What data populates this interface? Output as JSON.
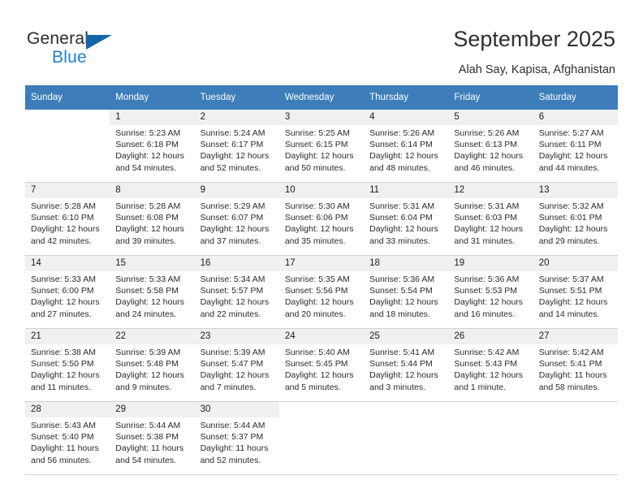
{
  "brand": {
    "word_one": "General",
    "word_two": "Blue",
    "triangle_color": "#1565a8",
    "blue_text_color": "#1f7fd0"
  },
  "header": {
    "title": "September 2025",
    "location": "Alah Say, Kapisa, Afghanistan"
  },
  "calendar": {
    "header_bg": "#3c7dba",
    "daynum_bg": "#f0f0f0",
    "weekday_headers": [
      "Sunday",
      "Monday",
      "Tuesday",
      "Wednesday",
      "Thursday",
      "Friday",
      "Saturday"
    ],
    "labels": {
      "sunrise": "Sunrise:",
      "sunset": "Sunset:",
      "daylight": "Daylight:"
    },
    "weeks": [
      [
        {
          "day": "",
          "sunrise": "",
          "sunset": "",
          "daylight": ""
        },
        {
          "day": "1",
          "sunrise": "Sunrise: 5:23 AM",
          "sunset": "Sunset: 6:18 PM",
          "daylight": "Daylight: 12 hours and 54 minutes."
        },
        {
          "day": "2",
          "sunrise": "Sunrise: 5:24 AM",
          "sunset": "Sunset: 6:17 PM",
          "daylight": "Daylight: 12 hours and 52 minutes."
        },
        {
          "day": "3",
          "sunrise": "Sunrise: 5:25 AM",
          "sunset": "Sunset: 6:15 PM",
          "daylight": "Daylight: 12 hours and 50 minutes."
        },
        {
          "day": "4",
          "sunrise": "Sunrise: 5:26 AM",
          "sunset": "Sunset: 6:14 PM",
          "daylight": "Daylight: 12 hours and 48 minutes."
        },
        {
          "day": "5",
          "sunrise": "Sunrise: 5:26 AM",
          "sunset": "Sunset: 6:13 PM",
          "daylight": "Daylight: 12 hours and 46 minutes."
        },
        {
          "day": "6",
          "sunrise": "Sunrise: 5:27 AM",
          "sunset": "Sunset: 6:11 PM",
          "daylight": "Daylight: 12 hours and 44 minutes."
        }
      ],
      [
        {
          "day": "7",
          "sunrise": "Sunrise: 5:28 AM",
          "sunset": "Sunset: 6:10 PM",
          "daylight": "Daylight: 12 hours and 42 minutes."
        },
        {
          "day": "8",
          "sunrise": "Sunrise: 5:28 AM",
          "sunset": "Sunset: 6:08 PM",
          "daylight": "Daylight: 12 hours and 39 minutes."
        },
        {
          "day": "9",
          "sunrise": "Sunrise: 5:29 AM",
          "sunset": "Sunset: 6:07 PM",
          "daylight": "Daylight: 12 hours and 37 minutes."
        },
        {
          "day": "10",
          "sunrise": "Sunrise: 5:30 AM",
          "sunset": "Sunset: 6:06 PM",
          "daylight": "Daylight: 12 hours and 35 minutes."
        },
        {
          "day": "11",
          "sunrise": "Sunrise: 5:31 AM",
          "sunset": "Sunset: 6:04 PM",
          "daylight": "Daylight: 12 hours and 33 minutes."
        },
        {
          "day": "12",
          "sunrise": "Sunrise: 5:31 AM",
          "sunset": "Sunset: 6:03 PM",
          "daylight": "Daylight: 12 hours and 31 minutes."
        },
        {
          "day": "13",
          "sunrise": "Sunrise: 5:32 AM",
          "sunset": "Sunset: 6:01 PM",
          "daylight": "Daylight: 12 hours and 29 minutes."
        }
      ],
      [
        {
          "day": "14",
          "sunrise": "Sunrise: 5:33 AM",
          "sunset": "Sunset: 6:00 PM",
          "daylight": "Daylight: 12 hours and 27 minutes."
        },
        {
          "day": "15",
          "sunrise": "Sunrise: 5:33 AM",
          "sunset": "Sunset: 5:58 PM",
          "daylight": "Daylight: 12 hours and 24 minutes."
        },
        {
          "day": "16",
          "sunrise": "Sunrise: 5:34 AM",
          "sunset": "Sunset: 5:57 PM",
          "daylight": "Daylight: 12 hours and 22 minutes."
        },
        {
          "day": "17",
          "sunrise": "Sunrise: 5:35 AM",
          "sunset": "Sunset: 5:56 PM",
          "daylight": "Daylight: 12 hours and 20 minutes."
        },
        {
          "day": "18",
          "sunrise": "Sunrise: 5:36 AM",
          "sunset": "Sunset: 5:54 PM",
          "daylight": "Daylight: 12 hours and 18 minutes."
        },
        {
          "day": "19",
          "sunrise": "Sunrise: 5:36 AM",
          "sunset": "Sunset: 5:53 PM",
          "daylight": "Daylight: 12 hours and 16 minutes."
        },
        {
          "day": "20",
          "sunrise": "Sunrise: 5:37 AM",
          "sunset": "Sunset: 5:51 PM",
          "daylight": "Daylight: 12 hours and 14 minutes."
        }
      ],
      [
        {
          "day": "21",
          "sunrise": "Sunrise: 5:38 AM",
          "sunset": "Sunset: 5:50 PM",
          "daylight": "Daylight: 12 hours and 11 minutes."
        },
        {
          "day": "22",
          "sunrise": "Sunrise: 5:39 AM",
          "sunset": "Sunset: 5:48 PM",
          "daylight": "Daylight: 12 hours and 9 minutes."
        },
        {
          "day": "23",
          "sunrise": "Sunrise: 5:39 AM",
          "sunset": "Sunset: 5:47 PM",
          "daylight": "Daylight: 12 hours and 7 minutes."
        },
        {
          "day": "24",
          "sunrise": "Sunrise: 5:40 AM",
          "sunset": "Sunset: 5:45 PM",
          "daylight": "Daylight: 12 hours and 5 minutes."
        },
        {
          "day": "25",
          "sunrise": "Sunrise: 5:41 AM",
          "sunset": "Sunset: 5:44 PM",
          "daylight": "Daylight: 12 hours and 3 minutes."
        },
        {
          "day": "26",
          "sunrise": "Sunrise: 5:42 AM",
          "sunset": "Sunset: 5:43 PM",
          "daylight": "Daylight: 12 hours and 1 minute."
        },
        {
          "day": "27",
          "sunrise": "Sunrise: 5:42 AM",
          "sunset": "Sunset: 5:41 PM",
          "daylight": "Daylight: 11 hours and 58 minutes."
        }
      ],
      [
        {
          "day": "28",
          "sunrise": "Sunrise: 5:43 AM",
          "sunset": "Sunset: 5:40 PM",
          "daylight": "Daylight: 11 hours and 56 minutes."
        },
        {
          "day": "29",
          "sunrise": "Sunrise: 5:44 AM",
          "sunset": "Sunset: 5:38 PM",
          "daylight": "Daylight: 11 hours and 54 minutes."
        },
        {
          "day": "30",
          "sunrise": "Sunrise: 5:44 AM",
          "sunset": "Sunset: 5:37 PM",
          "daylight": "Daylight: 11 hours and 52 minutes."
        },
        {
          "day": "",
          "sunrise": "",
          "sunset": "",
          "daylight": ""
        },
        {
          "day": "",
          "sunrise": "",
          "sunset": "",
          "daylight": ""
        },
        {
          "day": "",
          "sunrise": "",
          "sunset": "",
          "daylight": ""
        },
        {
          "day": "",
          "sunrise": "",
          "sunset": "",
          "daylight": ""
        }
      ]
    ]
  }
}
